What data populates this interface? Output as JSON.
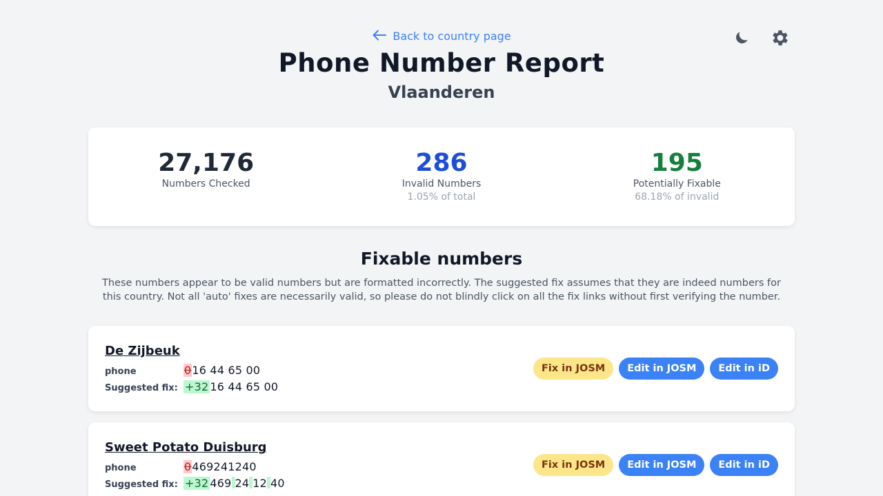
{
  "nav": {
    "back_label": "Back to country page"
  },
  "header": {
    "title": "Phone Number Report",
    "subtitle": "Vlaanderen"
  },
  "stats": {
    "checked_value": "27,176",
    "checked_label": "Numbers Checked",
    "invalid_value": "286",
    "invalid_label": "Invalid Numbers",
    "invalid_sub": "1.05% of total",
    "fixable_value": "195",
    "fixable_label": "Potentially Fixable",
    "fixable_sub": "68.18% of invalid"
  },
  "section": {
    "title": "Fixable numbers",
    "description": "These numbers appear to be valid numbers but are formatted incorrectly. The suggested fix assumes that they are indeed numbers for this country. Not all 'auto' fixes are necessarily valid, so please do not blindly click on all the fix links without first verifying the number."
  },
  "labels": {
    "phone": "phone",
    "suggested": "Suggested fix:"
  },
  "buttons": {
    "fix_josm": "Fix in JOSM",
    "edit_josm": "Edit in JOSM",
    "edit_id": "Edit in iD"
  },
  "items": [
    {
      "name": "De Zijbeuk",
      "phone_removed": "0",
      "phone_rest": "16 44 65 00",
      "fix_added": "+32",
      "fix_rest": "16 44 65 00"
    },
    {
      "name": "Sweet Potato Duisburg",
      "phone_removed": "0",
      "phone_rest": "469241240",
      "fix_added": "+32",
      "fix_parts": [
        "469",
        "24",
        "12",
        "40"
      ]
    }
  ],
  "colors": {
    "accent": "#3b82f6",
    "invalid": "#1d4ed8",
    "fixable": "#15803d",
    "fix_button": "#fde68a",
    "background": "#f3f4f6"
  },
  "icons": {
    "back": "arrow-left-icon",
    "theme": "moon-icon",
    "settings": "gear-icon"
  }
}
